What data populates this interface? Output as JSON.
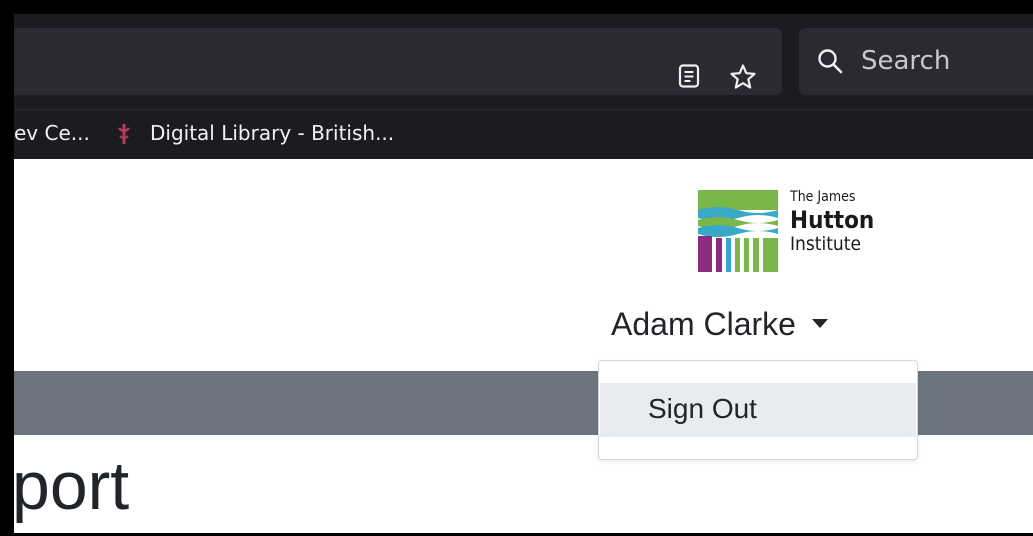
{
  "browser": {
    "search": {
      "placeholder": "Search"
    },
    "bookmarks": [
      {
        "label": "ev Ce..."
      },
      {
        "label": "Digital Library - British..."
      }
    ],
    "icons": [
      "reader-view-icon",
      "bookmark-star-icon",
      "search-icon",
      "bookmark-favicon"
    ]
  },
  "page": {
    "logo": {
      "line1": "The James",
      "line2": "Hutton",
      "line3": "Institute"
    },
    "user": {
      "name": "Adam Clarke"
    },
    "dropdown": {
      "items": [
        {
          "label": "Sign Out"
        }
      ]
    },
    "heading": "port"
  },
  "colors": {
    "toolbar_bg": "#1c1b22",
    "urlbar_bg": "#2b2a33",
    "nav_bar": "#6c757d",
    "dropdown_hover": "#e9ecef",
    "logo_green": "#7ab648",
    "logo_blue": "#3aa8c9",
    "logo_purple": "#8b2c7f"
  }
}
